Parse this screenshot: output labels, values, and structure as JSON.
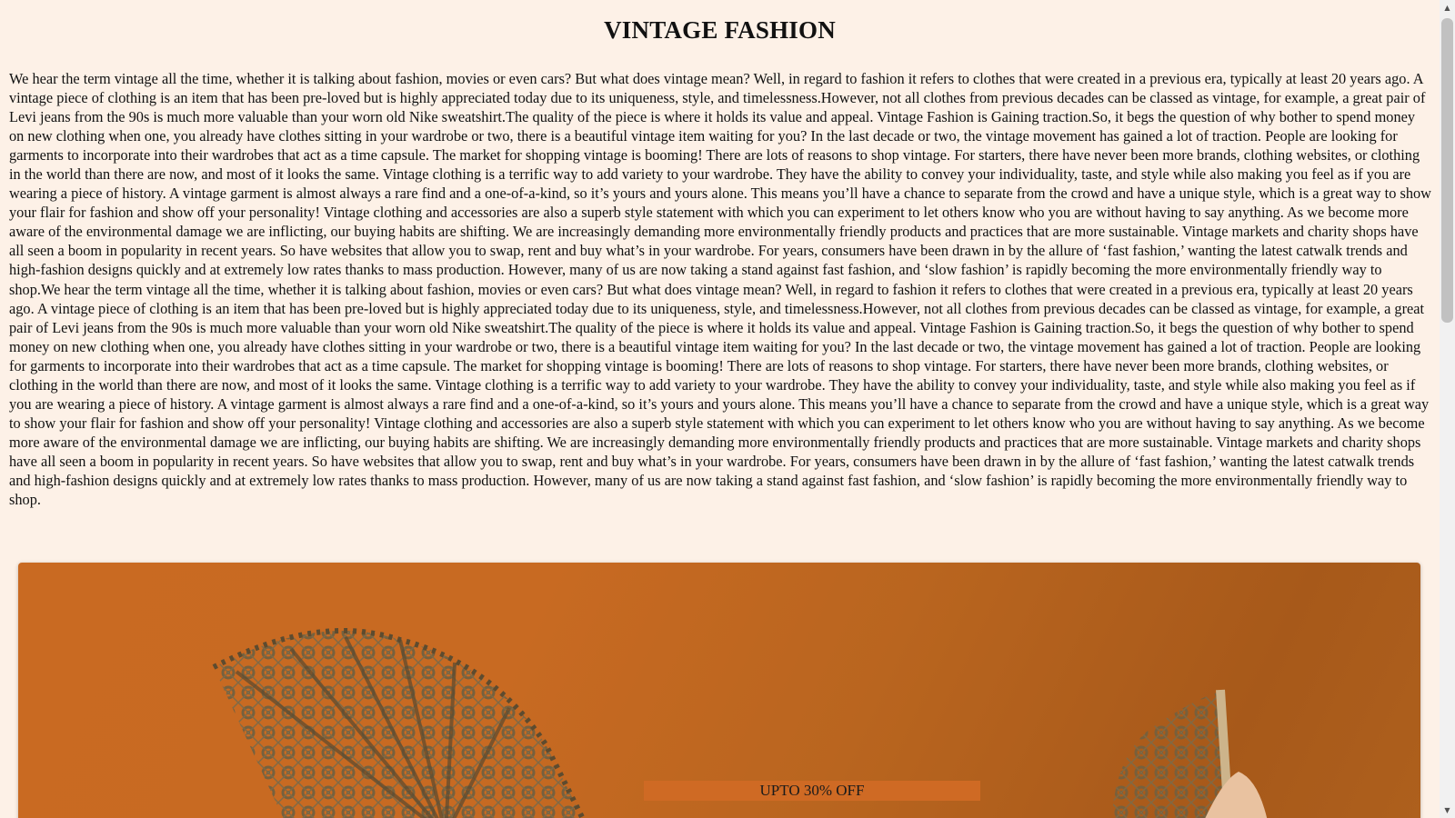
{
  "page": {
    "title": "VINTAGE FASHION",
    "article": "We hear the term vintage all the time, whether it is talking about fashion, movies or even cars? But what does vintage mean? Well, in regard to fashion it refers to clothes that were created in a previous era, typically at least 20 years ago. A vintage piece of clothing is an item that has been pre-loved but is highly appreciated today due to its uniqueness, style, and timelessness.However, not all clothes from previous decades can be classed as vintage, for example, a great pair of Levi jeans from the 90s is much more valuable than your worn old Nike sweatshirt.The quality of the piece is where it holds its value and appeal. Vintage Fashion is Gaining traction.So, it begs the question of why bother to spend money on new clothing when one, you already have clothes sitting in your wardrobe or two, there is a beautiful vintage item waiting for you? In the last decade or two, the vintage movement has gained a lot of traction. People are looking for garments to incorporate into their wardrobes that act as a time capsule. The market for shopping vintage is booming! There are lots of reasons to shop vintage. For starters, there have never been more brands, clothing websites, or clothing in the world than there are now, and most of it looks the same. Vintage clothing is a terrific way to add variety to your wardrobe. They have the ability to convey your individuality, taste, and style while also making you feel as if you are wearing a piece of history. A vintage garment is almost always a rare find and a one-of-a-kind, so it’s yours and yours alone. This means you’ll have a chance to separate from the crowd and have a unique style, which is a great way to show your flair for fashion and show off your personality! Vintage clothing and accessories are also a superb style statement with which you can experiment to let others know who you are without having to say anything. As we become more aware of the environmental damage we are inflicting, our buying habits are shifting. We are increasingly demanding more environmentally friendly products and practices that are more sustainable. Vintage markets and charity shops have all seen a boom in popularity in recent years. So have websites that allow you to swap, rent and buy what’s in your wardrobe. For years, consumers have been drawn in by the allure of ‘fast fashion,’ wanting the latest catwalk trends and high-fashion designs quickly and at extremely low rates thanks to mass production. However, many of us are now taking a stand against fast fashion, and ‘slow fashion’ is rapidly becoming the more environmentally friendly way to shop.We hear the term vintage all the time, whether it is talking about fashion, movies or even cars? But what does vintage mean? Well, in regard to fashion it refers to clothes that were created in a previous era, typically at least 20 years ago. A vintage piece of clothing is an item that has been pre-loved but is highly appreciated today due to its uniqueness, style, and timelessness.However, not all clothes from previous decades can be classed as vintage, for example, a great pair of Levi jeans from the 90s is much more valuable than your worn old Nike sweatshirt.The quality of the piece is where it holds its value and appeal. Vintage Fashion is Gaining traction.So, it begs the question of why bother to spend money on new clothing when one, you already have clothes sitting in your wardrobe or two, there is a beautiful vintage item waiting for you? In the last decade or two, the vintage movement has gained a lot of traction. People are looking for garments to incorporate into their wardrobes that act as a time capsule. The market for shopping vintage is booming! There are lots of reasons to shop vintage. For starters, there have never been more brands, clothing websites, or clothing in the world than there are now, and most of it looks the same. Vintage clothing is a terrific way to add variety to your wardrobe. They have the ability to convey your individuality, taste, and style while also making you feel as if you are wearing a piece of history. A vintage garment is almost always a rare find and a one-of-a-kind, so it’s yours and yours alone. This means you’ll have a chance to separate from the crowd and have a unique style, which is a great way to show your flair for fashion and show off your personality! Vintage clothing and accessories are also a superb style statement with which you can experiment to let others know who you are without having to say anything. As we become more aware of the environmental damage we are inflicting, our buying habits are shifting. We are increasingly demanding more environmentally friendly products and practices that are more sustainable. Vintage markets and charity shops have all seen a boom in popularity in recent years. So have websites that allow you to swap, rent and buy what’s in your wardrobe. For years, consumers have been drawn in by the allure of ‘fast fashion,’ wanting the latest catwalk trends and high-fashion designs quickly and at extremely low rates thanks to mass production. However, many of us are now taking a stand against fast fashion, and ‘slow fashion’ is rapidly becoming the more environmentally friendly way to shop."
  },
  "banner": {
    "offer_text": "UPTO 30% OFF",
    "colors": {
      "background": "#c96a22",
      "label_bg": "#cf6a24",
      "lace": "#6f5a3c"
    }
  },
  "scrollbar": {
    "up_icon": "arrow-up-icon",
    "down_icon": "arrow-down-icon"
  }
}
